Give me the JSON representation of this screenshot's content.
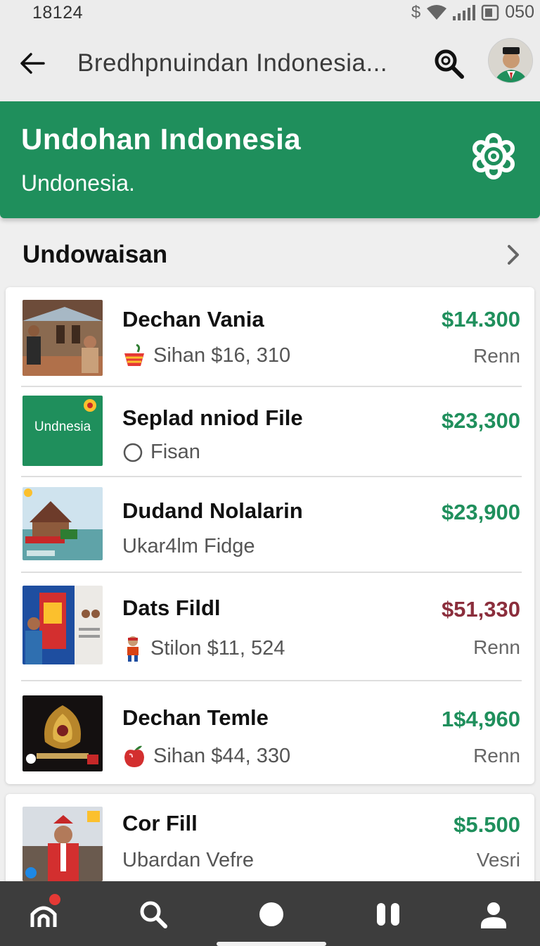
{
  "status_bar": {
    "time": "18124",
    "currency_symbol": "$",
    "battery_text": "050"
  },
  "app_bar": {
    "title": "Bredhpnuindan Indonesia..."
  },
  "banner": {
    "title": "Undohan Indonesia",
    "subtitle": "Undonesia.",
    "color": "#1f8f5c"
  },
  "section": {
    "title": "Undowaisan"
  },
  "items": [
    {
      "name": "Dechan Vania",
      "meta": "Sihan $16, 310",
      "meta_icon": "fruit-basket-icon",
      "price": "$14.300",
      "price_color": "#1f8f5c",
      "tag": "Renn"
    },
    {
      "name": "Seplad nniod File",
      "meta": "Fisan",
      "meta_icon": "radio-circle-icon",
      "price": "$23,300",
      "price_color": "#1f8f5c",
      "tag": "",
      "thumb_text": "Undnesia"
    },
    {
      "name": "Dudand Nolalarin",
      "meta": "Ukar4lm Fidge",
      "meta_icon": "",
      "price": "$23,900",
      "price_color": "#1f8f5c",
      "tag": ""
    },
    {
      "name": "Dats Fildl",
      "meta": "Stilon $11, 524",
      "meta_icon": "figure-icon",
      "price": "$51,330",
      "price_color": "#8b2e3c",
      "tag": "Renn"
    },
    {
      "name": "Dechan Temle",
      "meta": "Sihan $44, 330",
      "meta_icon": "apple-icon",
      "price": "1$4,960",
      "price_color": "#1f8f5c",
      "tag": "Renn"
    },
    {
      "name": "Cor Fill",
      "meta": "Ubardan Vefre",
      "meta_icon": "",
      "price": "$5.500",
      "price_color": "#1f8f5c",
      "tag": "Vesri"
    }
  ],
  "nav": [
    {
      "icon": "home-icon"
    },
    {
      "icon": "search-icon"
    },
    {
      "icon": "circle-icon"
    },
    {
      "icon": "pause-icon"
    },
    {
      "icon": "profile-icon"
    }
  ]
}
